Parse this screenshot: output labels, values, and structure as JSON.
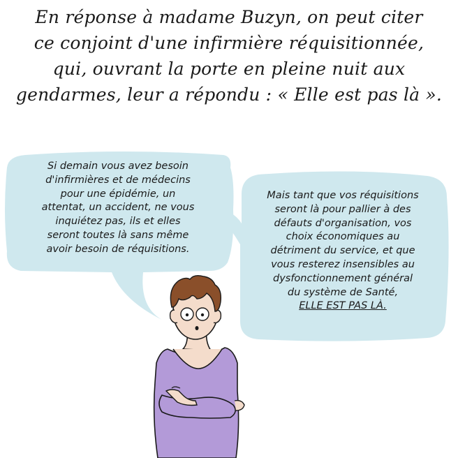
{
  "caption": {
    "lines": [
      "En réponse à madame Buzyn, on peut citer",
      "ce conjoint d'une infirmière réquisitionnée,",
      "qui, ouvrant la porte en pleine nuit aux",
      "gendarmes, leur a répondu : « Elle est pas là »."
    ]
  },
  "bubble_left": {
    "lines": [
      "Si demain vous avez besoin",
      "d'infirmières et de médecins",
      "pour une épidémie, un",
      "attentat, un accident, ne vous",
      "inquiétez pas, ils et elles",
      "seront toutes là sans même",
      "avoir besoin de réquisitions."
    ]
  },
  "bubble_right": {
    "lines": [
      "Mais tant que vos réquisitions",
      "seront là pour pallier à des",
      "défauts d'organisation, vos",
      "choix économiques au",
      "détriment du service, et que",
      "vous resterez insensibles au",
      "dysfonctionnement  général",
      "du système de Santé,",
      "ELLE EST PAS LÀ."
    ]
  },
  "colors": {
    "bubble": "#cfe8ee",
    "shirt": "#b39ad8",
    "skin": "#f4dccb",
    "hair": "#8a4f2a"
  }
}
